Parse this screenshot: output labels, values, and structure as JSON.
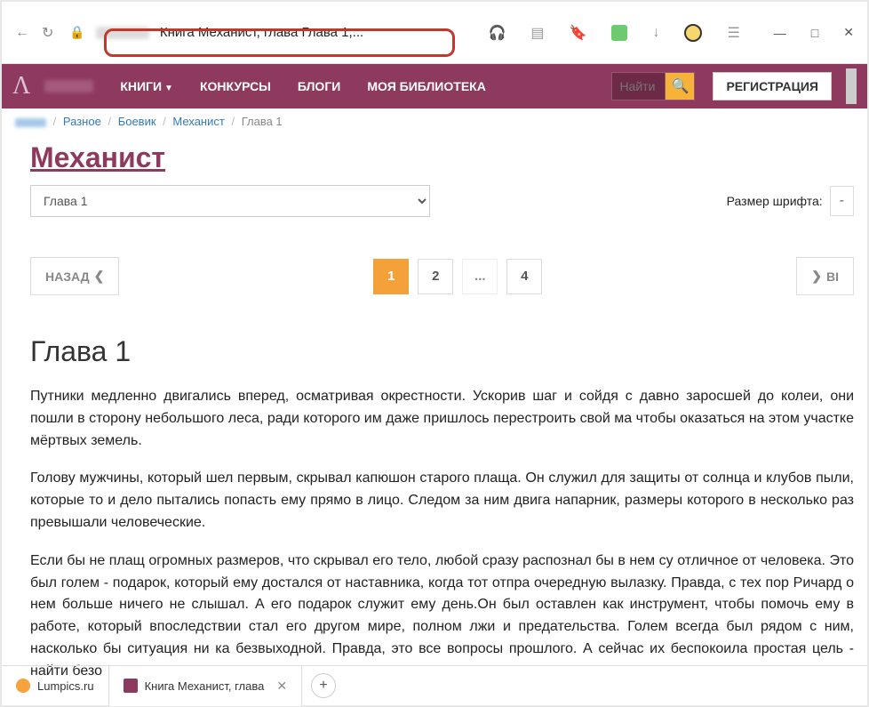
{
  "browser": {
    "address_title": "Книга Механист, глава Глава 1,..."
  },
  "header": {
    "nav": {
      "books": "КНИГИ",
      "contests": "КОНКУРСЫ",
      "blogs": "БЛОГИ",
      "library": "МОЯ БИБЛИОТЕКА"
    },
    "search_placeholder": "Найти",
    "register": "РЕГИСТРАЦИЯ"
  },
  "breadcrumb": {
    "cat1": "Разное",
    "cat2": "Боевик",
    "book": "Механист",
    "current": "Глава 1"
  },
  "book": {
    "title": "Механист",
    "chapter_select": "Глава 1",
    "font_size_label": "Размер шрифта:",
    "font_minus": "-"
  },
  "pager": {
    "back": "НАЗАД",
    "forward": "ВІ",
    "p1": "1",
    "p2": "2",
    "ellipsis": "...",
    "p4": "4"
  },
  "chapter": {
    "heading": "Глава 1",
    "p1": "Путники медленно двигались вперед, осматривая окрестности.  Ускорив шаг и сойдя с давно заросшей до колеи, они пошли в сторону небольшого леса, ради которого им даже пришлось перестроить свой ма чтобы оказаться на этом участке мёртвых земель.",
    "p2": "Голову мужчины, который шел первым, скрывал капюшон старого плаща. Он служил для защиты от солнца и клубов пыли, которые то и дело пытались попасть ему прямо в лицо. Следом за ним двига напарник, размеры которого в несколько раз превышали человеческие.",
    "p3": "Если бы не плащ огромных размеров, что скрывал его тело, любой сразу распознал бы в нем су отличное от человека. Это был голем - подарок, который ему достался от наставника, когда тот отпра очередную вылазку. Правда, с тех пор Ричард о нем больше ничего не слышал. А его подарок служит ему день.Он был оставлен как инструмент, чтобы помочь ему в работе, который впоследствии стал его другом мире, полном лжи и предательства. Голем всегда был рядом с ним, насколько бы ситуация ни ка безвыходной. Правда, это все вопросы прошлого. А сейчас их беспокоила простая цель - найти безо"
  },
  "tabs": {
    "t1": "Lumpics.ru",
    "t2": "Книга Механист, глава"
  }
}
